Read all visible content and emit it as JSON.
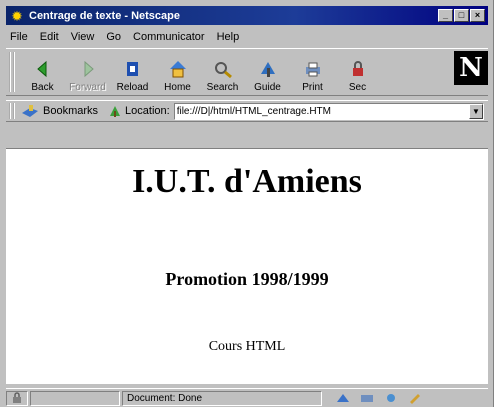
{
  "window": {
    "title": "Centrage de texte - Netscape",
    "buttons": {
      "minimize": "_",
      "maximize": "□",
      "close": "×"
    }
  },
  "menu": [
    "File",
    "Edit",
    "View",
    "Go",
    "Communicator",
    "Help"
  ],
  "toolbar": {
    "buttons": [
      {
        "label": "Back",
        "icon": "back-arrow-icon",
        "enabled": true
      },
      {
        "label": "Forward",
        "icon": "forward-arrow-icon",
        "enabled": false
      },
      {
        "label": "Reload",
        "icon": "reload-icon",
        "enabled": true
      },
      {
        "label": "Home",
        "icon": "home-icon",
        "enabled": true
      },
      {
        "label": "Search",
        "icon": "search-icon",
        "enabled": true
      },
      {
        "label": "Guide",
        "icon": "guide-icon",
        "enabled": true
      },
      {
        "label": "Print",
        "icon": "print-icon",
        "enabled": true
      },
      {
        "label": "Sec",
        "icon": "security-icon",
        "enabled": true
      }
    ],
    "logo": "N"
  },
  "location": {
    "bookmarks_label": "Bookmarks",
    "location_label": "Location:",
    "url": "file:///D|/html/HTML_centrage.HTM"
  },
  "content": {
    "heading1": "I.U.T. d'Amiens",
    "heading2": "Promotion 1998/1999",
    "paragraph": "Cours HTML"
  },
  "status": {
    "text": "Document: Done"
  },
  "colors": {
    "titlebar": "#0a246a",
    "chrome": "#c0c0c0",
    "content_bg": "#ffffff"
  }
}
